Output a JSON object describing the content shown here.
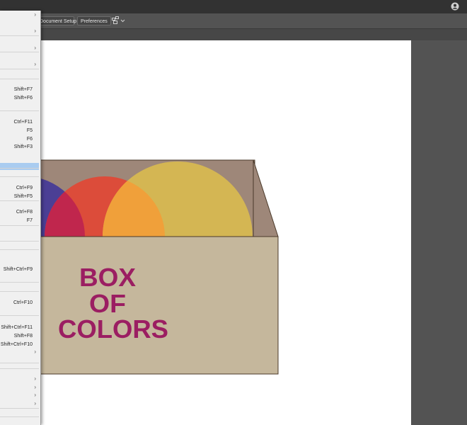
{
  "toolbar": {
    "document_setup_label": "Document Setup",
    "preferences_label": "Preferences",
    "arrange_icon": "arrange-documents-icon",
    "user_icon": "user-account-icon"
  },
  "artwork": {
    "line1": "BOX",
    "line2": "OF",
    "line3": "COLORS",
    "colors": {
      "box_front": "#c5b79c",
      "box_inside": "#9e8779",
      "box_stroke": "#4b3a2a",
      "text": "#9b1e62",
      "ball_purple": "#4b3f95",
      "ball_red": "#dc4c3a",
      "ball_yellow": "#d4b653",
      "overlap_crimson": "#c0264d",
      "overlap_orange": "#f0a03a"
    }
  },
  "menu": {
    "items": [
      {
        "shortcut": "",
        "submenu": true
      },
      {
        "shortcut": "",
        "submenu": true
      },
      {
        "shortcut": "",
        "submenu": true
      },
      {
        "shortcut": "",
        "submenu": true
      },
      {
        "shortcut": "Shift+F7",
        "submenu": false
      },
      {
        "shortcut": "Shift+F6",
        "submenu": false
      },
      {
        "shortcut": "Ctrl+F11",
        "submenu": false
      },
      {
        "shortcut": "F5",
        "submenu": false
      },
      {
        "shortcut": "F6",
        "submenu": false
      },
      {
        "shortcut": "Shift+F3",
        "submenu": false
      },
      {
        "shortcut": "",
        "submenu": false
      },
      {
        "shortcut": "Ctrl+F9",
        "submenu": false
      },
      {
        "shortcut": "Shift+F5",
        "submenu": false
      },
      {
        "shortcut": "Ctrl+F8",
        "submenu": false
      },
      {
        "shortcut": "F7",
        "submenu": false
      },
      {
        "shortcut": "Shift+Ctrl+F9",
        "submenu": false
      },
      {
        "shortcut": "Ctrl+F10",
        "submenu": false
      },
      {
        "shortcut": "Shift+Ctrl+F11",
        "submenu": false
      },
      {
        "shortcut": "Shift+F8",
        "submenu": false
      },
      {
        "shortcut": "Shift+Ctrl+F10",
        "submenu": false
      },
      {
        "shortcut": "",
        "submenu": true
      },
      {
        "shortcut": "",
        "submenu": true
      },
      {
        "shortcut": "",
        "submenu": true
      },
      {
        "shortcut": "",
        "submenu": true
      },
      {
        "shortcut": "",
        "submenu": true
      }
    ],
    "highlighted_index": 10
  }
}
